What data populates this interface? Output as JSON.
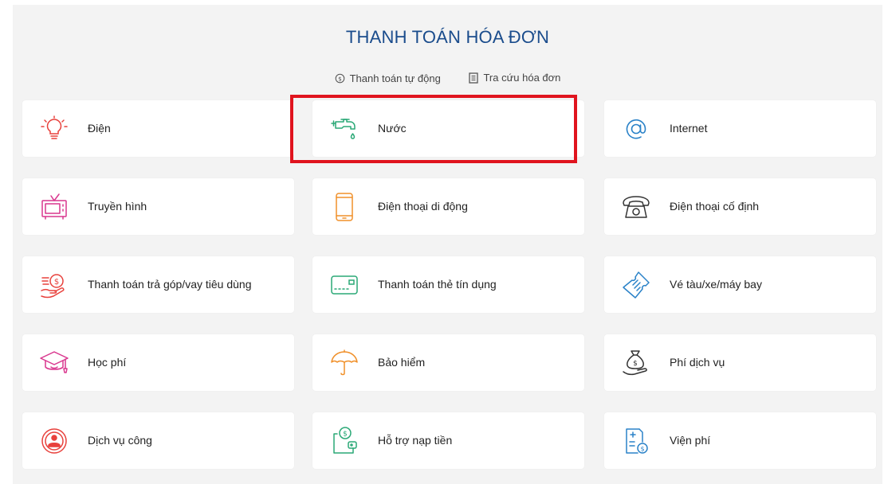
{
  "page": {
    "title": "THANH TOÁN HÓA ĐƠN",
    "links": [
      {
        "label": "Thanh toán tự động",
        "icon": "dollar-circle-icon"
      },
      {
        "label": "Tra cứu hóa đơn",
        "icon": "receipt-icon"
      }
    ]
  },
  "services": [
    {
      "label": "Điện",
      "icon": "lightbulb-icon",
      "color": "#e8413c"
    },
    {
      "label": "Nước",
      "icon": "water-tap-icon",
      "color": "#2aa876"
    },
    {
      "label": "Internet",
      "icon": "at-sign-icon",
      "color": "#2a82c8"
    },
    {
      "label": "Truyền hình",
      "icon": "tv-icon",
      "color": "#d9368e"
    },
    {
      "label": "Điện thoại di động",
      "icon": "mobile-phone-icon",
      "color": "#f0902a"
    },
    {
      "label": "Điện thoại cố định",
      "icon": "landline-phone-icon",
      "color": "#333333"
    },
    {
      "label": "Thanh toán trả góp/vay tiêu dùng",
      "icon": "coin-hand-icon",
      "color": "#e8413c"
    },
    {
      "label": "Thanh toán thẻ tín dụng",
      "icon": "credit-card-icon",
      "color": "#2aa876"
    },
    {
      "label": "Vé tàu/xe/máy bay",
      "icon": "ticket-icon",
      "color": "#2a82c8"
    },
    {
      "label": "Học phí",
      "icon": "graduation-cap-icon",
      "color": "#d9368e"
    },
    {
      "label": "Bảo hiểm",
      "icon": "umbrella-icon",
      "color": "#f0902a"
    },
    {
      "label": "Phí dịch vụ",
      "icon": "money-bag-icon",
      "color": "#333333"
    },
    {
      "label": "Dịch vụ công",
      "icon": "public-seal-icon",
      "color": "#e8413c"
    },
    {
      "label": "Hỗ trợ nạp tiền",
      "icon": "wallet-topup-icon",
      "color": "#2aa876"
    },
    {
      "label": "Viện phí",
      "icon": "medical-bill-icon",
      "color": "#2a82c8"
    }
  ]
}
